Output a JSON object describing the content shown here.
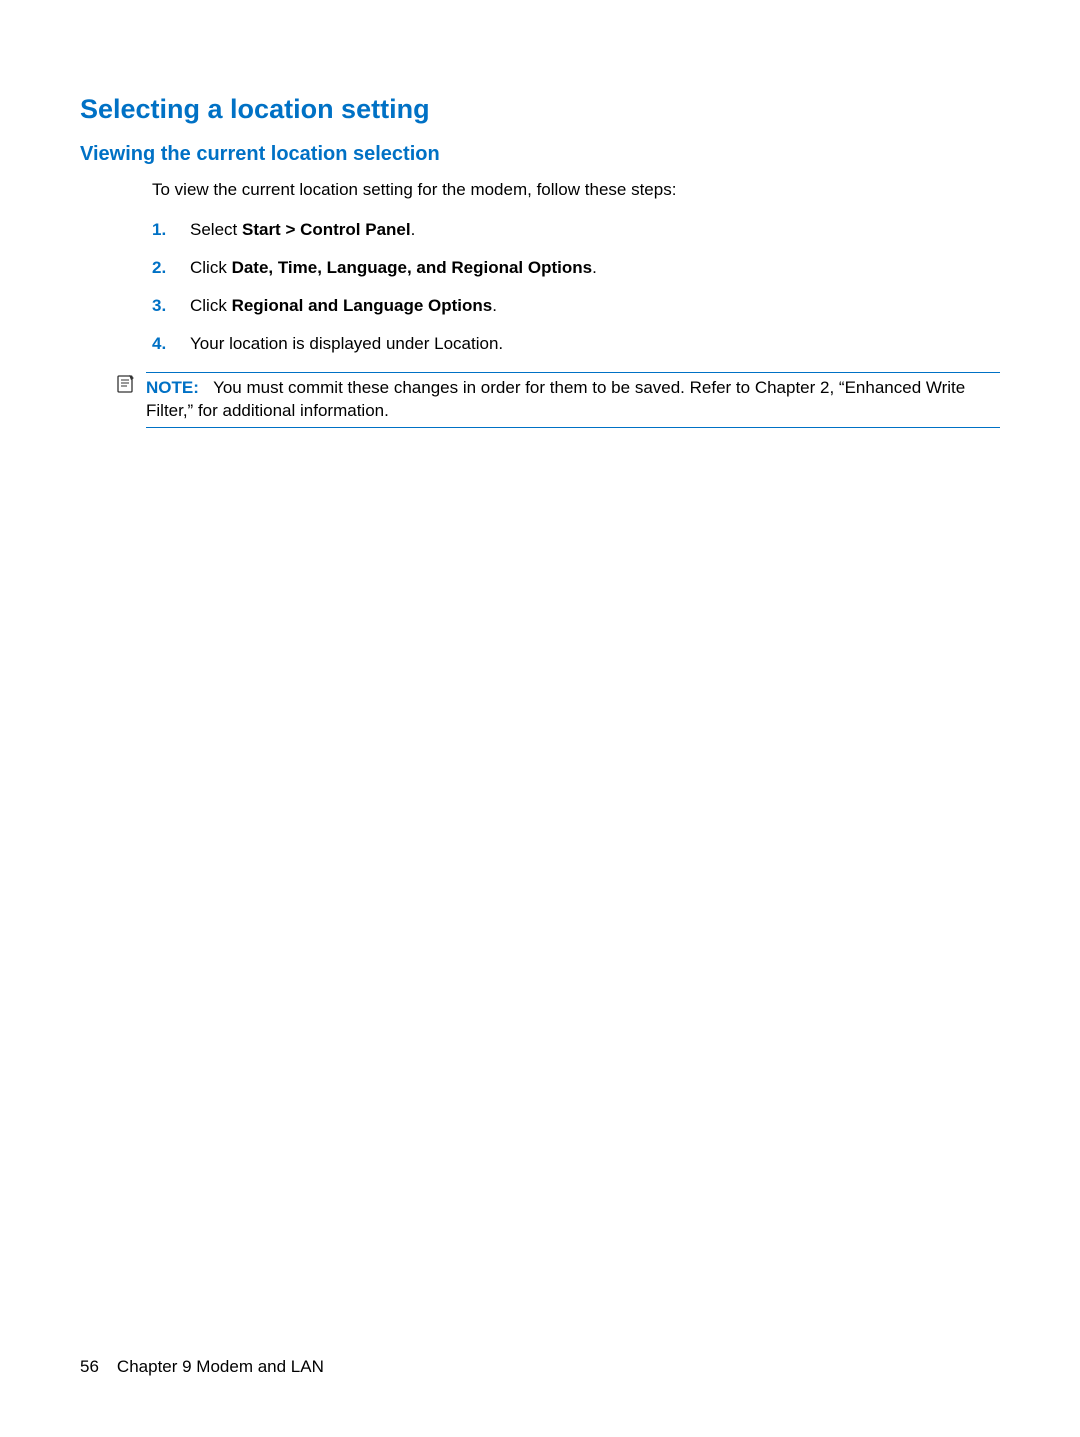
{
  "heading1": "Selecting a location setting",
  "heading2": "Viewing the current location selection",
  "intro": "To view the current location setting for the modem, follow these steps:",
  "steps": [
    {
      "num": "1.",
      "pre": "Select ",
      "bold": "Start > Control Panel",
      "post": "."
    },
    {
      "num": "2.",
      "pre": "Click ",
      "bold": "Date, Time, Language, and Regional Options",
      "post": "."
    },
    {
      "num": "3.",
      "pre": "Click ",
      "bold": "Regional and Language Options",
      "post": "."
    },
    {
      "num": "4.",
      "pre": "Your location is displayed under Location.",
      "bold": "",
      "post": ""
    }
  ],
  "note": {
    "label": "NOTE:",
    "text": "You must commit these changes in order for them to be saved. Refer to Chapter 2, “Enhanced Write Filter,” for additional information."
  },
  "footer": {
    "page": "56",
    "chapter": "Chapter 9   Modem and LAN"
  }
}
